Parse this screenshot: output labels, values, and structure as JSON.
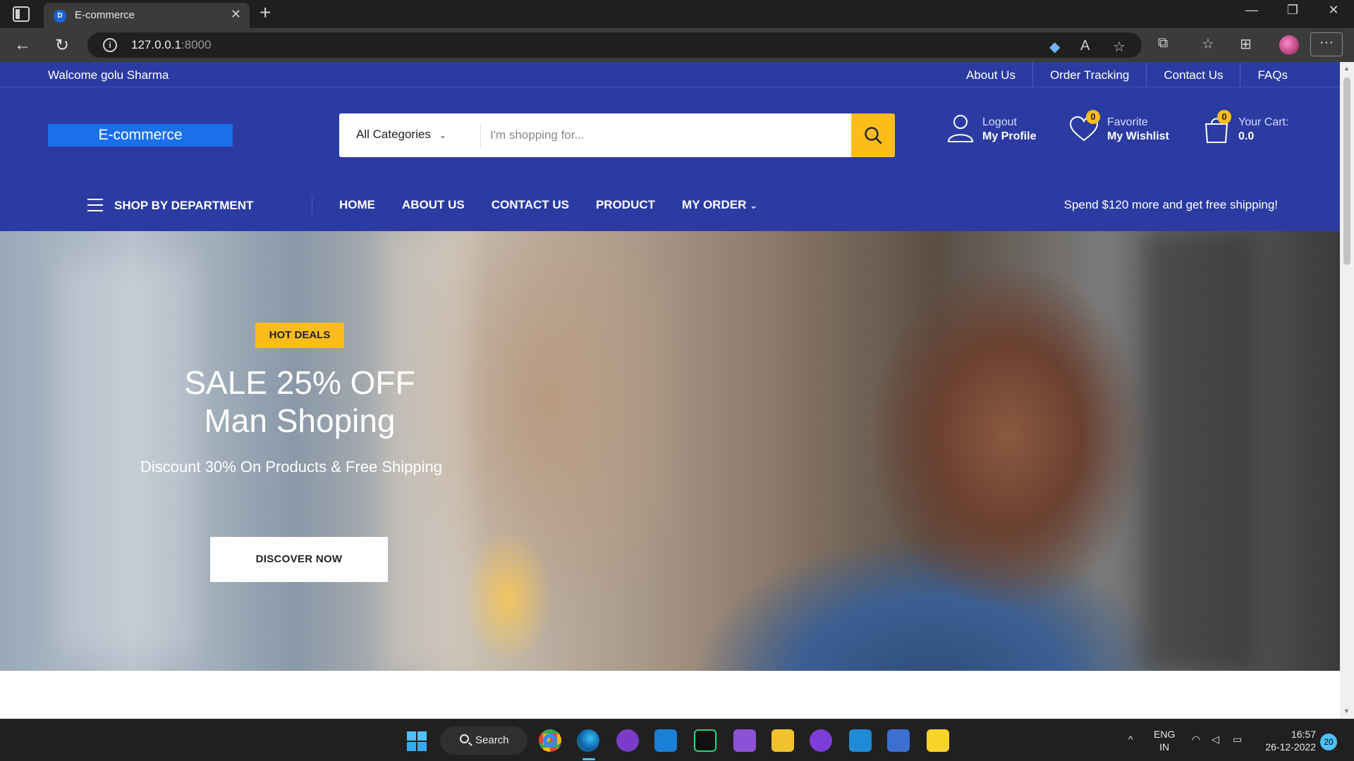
{
  "browser": {
    "tab_title": "E-commerce",
    "url_host": "127.0.0.1",
    "url_port": ":8000",
    "icons": [
      "tab-actions-icon",
      "back-icon",
      "refresh-icon",
      "info-icon",
      "coupon-icon",
      "read-aloud-icon",
      "favorite-add-icon",
      "extensions-icon",
      "favorites-icon",
      "collections-icon",
      "profile-icon",
      "more-icon"
    ]
  },
  "topbar": {
    "welcome": "Walcome golu Sharma",
    "links": [
      "About Us",
      "Order Tracking",
      "Contact Us",
      "FAQs"
    ]
  },
  "header": {
    "logo": "E-commerce",
    "category_select": "All Categories",
    "search_placeholder": "I'm shopping for...",
    "account": {
      "line1": "Logout",
      "line2": "My Profile"
    },
    "wishlist": {
      "count": "0",
      "line1": "Favorite",
      "line2": "My Wishlist"
    },
    "cart": {
      "count": "0",
      "line1": "Your Cart:",
      "line2": "0.0"
    },
    "colors": {
      "primary": "#2b3ba2",
      "accent": "#fcbd1c",
      "logo_bg": "#1b6fe8"
    }
  },
  "menu": {
    "department": "SHOP BY DEPARTMENT",
    "nav": [
      "HOME",
      "ABOUT US",
      "CONTACT US",
      "PRODUCT",
      "MY ORDER"
    ],
    "shipping_note": "Spend $120 more and get free shipping!"
  },
  "hero": {
    "badge": "HOT DEALS",
    "title_line1": "SALE 25% OFF",
    "title_line2": "Man Shoping",
    "subtitle": "Discount 30% On Products & Free Shipping",
    "button": "DISCOVER NOW",
    "slides": 3,
    "active_slide": 3
  },
  "taskbar": {
    "search_label": "Search",
    "language_line1": "ENG",
    "language_line2": "IN",
    "time": "16:57",
    "date": "26-12-2022",
    "notifications": "20"
  }
}
